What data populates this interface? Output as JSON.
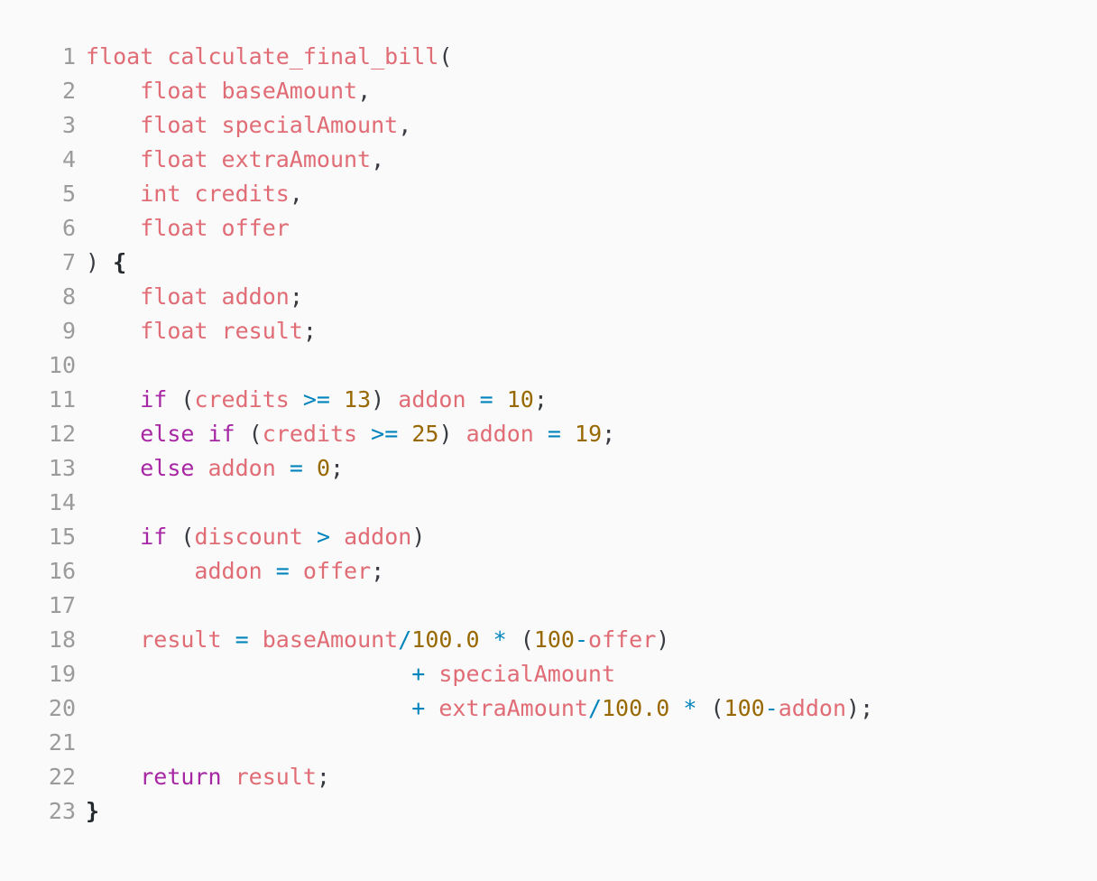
{
  "editor": {
    "language": "c",
    "background_color": "#fafafa",
    "gutter_color": "#9b9b9b",
    "palette": {
      "identifier": "#e06c75",
      "keyword": "#a626a4",
      "number": "#986801",
      "operator": "#0184bc",
      "punctuation": "#383a42",
      "brace": "#24292e"
    },
    "total_lines": 23
  },
  "code": {
    "lines": [
      {
        "number": "1",
        "text": "float calculate_final_bill(",
        "tokens": [
          {
            "t": "float",
            "c": "tok-type"
          },
          {
            "t": " ",
            "c": "tok-plain"
          },
          {
            "t": "calculate_final_bill",
            "c": "tok-fn"
          },
          {
            "t": "(",
            "c": "tok-paren"
          }
        ]
      },
      {
        "number": "2",
        "text": "    float baseAmount,",
        "tokens": [
          {
            "t": "    ",
            "c": "tok-plain"
          },
          {
            "t": "float",
            "c": "tok-type"
          },
          {
            "t": " ",
            "c": "tok-plain"
          },
          {
            "t": "baseAmount",
            "c": "tok-ident"
          },
          {
            "t": ",",
            "c": "tok-punct"
          }
        ]
      },
      {
        "number": "3",
        "text": "    float specialAmount,",
        "tokens": [
          {
            "t": "    ",
            "c": "tok-plain"
          },
          {
            "t": "float",
            "c": "tok-type"
          },
          {
            "t": " ",
            "c": "tok-plain"
          },
          {
            "t": "specialAmount",
            "c": "tok-ident"
          },
          {
            "t": ",",
            "c": "tok-punct"
          }
        ]
      },
      {
        "number": "4",
        "text": "    float extraAmount,",
        "tokens": [
          {
            "t": "    ",
            "c": "tok-plain"
          },
          {
            "t": "float",
            "c": "tok-type"
          },
          {
            "t": " ",
            "c": "tok-plain"
          },
          {
            "t": "extraAmount",
            "c": "tok-ident"
          },
          {
            "t": ",",
            "c": "tok-punct"
          }
        ]
      },
      {
        "number": "5",
        "text": "    int credits,",
        "tokens": [
          {
            "t": "    ",
            "c": "tok-plain"
          },
          {
            "t": "int",
            "c": "tok-type"
          },
          {
            "t": " ",
            "c": "tok-plain"
          },
          {
            "t": "credits",
            "c": "tok-ident"
          },
          {
            "t": ",",
            "c": "tok-punct"
          }
        ]
      },
      {
        "number": "6",
        "text": "    float offer",
        "tokens": [
          {
            "t": "    ",
            "c": "tok-plain"
          },
          {
            "t": "float",
            "c": "tok-type"
          },
          {
            "t": " ",
            "c": "tok-plain"
          },
          {
            "t": "offer",
            "c": "tok-ident"
          }
        ]
      },
      {
        "number": "7",
        "text": ") {",
        "tokens": [
          {
            "t": ")",
            "c": "tok-paren"
          },
          {
            "t": " ",
            "c": "tok-plain"
          },
          {
            "t": "{",
            "c": "tok-brace"
          }
        ]
      },
      {
        "number": "8",
        "text": "    float addon;",
        "tokens": [
          {
            "t": "    ",
            "c": "tok-plain"
          },
          {
            "t": "float",
            "c": "tok-type"
          },
          {
            "t": " ",
            "c": "tok-plain"
          },
          {
            "t": "addon",
            "c": "tok-ident"
          },
          {
            "t": ";",
            "c": "tok-punct"
          }
        ]
      },
      {
        "number": "9",
        "text": "    float result;",
        "tokens": [
          {
            "t": "    ",
            "c": "tok-plain"
          },
          {
            "t": "float",
            "c": "tok-type"
          },
          {
            "t": " ",
            "c": "tok-plain"
          },
          {
            "t": "result",
            "c": "tok-ident"
          },
          {
            "t": ";",
            "c": "tok-punct"
          }
        ]
      },
      {
        "number": "10",
        "text": "",
        "tokens": []
      },
      {
        "number": "11",
        "text": "    if (credits >= 13) addon = 10;",
        "tokens": [
          {
            "t": "    ",
            "c": "tok-plain"
          },
          {
            "t": "if",
            "c": "tok-kw"
          },
          {
            "t": " ",
            "c": "tok-plain"
          },
          {
            "t": "(",
            "c": "tok-paren"
          },
          {
            "t": "credits",
            "c": "tok-ident"
          },
          {
            "t": " ",
            "c": "tok-plain"
          },
          {
            "t": ">=",
            "c": "tok-op"
          },
          {
            "t": " ",
            "c": "tok-plain"
          },
          {
            "t": "13",
            "c": "tok-num"
          },
          {
            "t": ")",
            "c": "tok-paren"
          },
          {
            "t": " ",
            "c": "tok-plain"
          },
          {
            "t": "addon",
            "c": "tok-ident"
          },
          {
            "t": " ",
            "c": "tok-plain"
          },
          {
            "t": "=",
            "c": "tok-op"
          },
          {
            "t": " ",
            "c": "tok-plain"
          },
          {
            "t": "10",
            "c": "tok-num"
          },
          {
            "t": ";",
            "c": "tok-punct"
          }
        ]
      },
      {
        "number": "12",
        "text": "    else if (credits >= 25) addon = 19;",
        "tokens": [
          {
            "t": "    ",
            "c": "tok-plain"
          },
          {
            "t": "else",
            "c": "tok-kw"
          },
          {
            "t": " ",
            "c": "tok-plain"
          },
          {
            "t": "if",
            "c": "tok-kw"
          },
          {
            "t": " ",
            "c": "tok-plain"
          },
          {
            "t": "(",
            "c": "tok-paren"
          },
          {
            "t": "credits",
            "c": "tok-ident"
          },
          {
            "t": " ",
            "c": "tok-plain"
          },
          {
            "t": ">=",
            "c": "tok-op"
          },
          {
            "t": " ",
            "c": "tok-plain"
          },
          {
            "t": "25",
            "c": "tok-num"
          },
          {
            "t": ")",
            "c": "tok-paren"
          },
          {
            "t": " ",
            "c": "tok-plain"
          },
          {
            "t": "addon",
            "c": "tok-ident"
          },
          {
            "t": " ",
            "c": "tok-plain"
          },
          {
            "t": "=",
            "c": "tok-op"
          },
          {
            "t": " ",
            "c": "tok-plain"
          },
          {
            "t": "19",
            "c": "tok-num"
          },
          {
            "t": ";",
            "c": "tok-punct"
          }
        ]
      },
      {
        "number": "13",
        "text": "    else addon = 0;",
        "tokens": [
          {
            "t": "    ",
            "c": "tok-plain"
          },
          {
            "t": "else",
            "c": "tok-kw"
          },
          {
            "t": " ",
            "c": "tok-plain"
          },
          {
            "t": "addon",
            "c": "tok-ident"
          },
          {
            "t": " ",
            "c": "tok-plain"
          },
          {
            "t": "=",
            "c": "tok-op"
          },
          {
            "t": " ",
            "c": "tok-plain"
          },
          {
            "t": "0",
            "c": "tok-num"
          },
          {
            "t": ";",
            "c": "tok-punct"
          }
        ]
      },
      {
        "number": "14",
        "text": "",
        "tokens": []
      },
      {
        "number": "15",
        "text": "    if (discount > addon)",
        "tokens": [
          {
            "t": "    ",
            "c": "tok-plain"
          },
          {
            "t": "if",
            "c": "tok-kw"
          },
          {
            "t": " ",
            "c": "tok-plain"
          },
          {
            "t": "(",
            "c": "tok-paren"
          },
          {
            "t": "discount",
            "c": "tok-ident"
          },
          {
            "t": " ",
            "c": "tok-plain"
          },
          {
            "t": ">",
            "c": "tok-op"
          },
          {
            "t": " ",
            "c": "tok-plain"
          },
          {
            "t": "addon",
            "c": "tok-ident"
          },
          {
            "t": ")",
            "c": "tok-paren"
          }
        ]
      },
      {
        "number": "16",
        "text": "        addon = offer;",
        "tokens": [
          {
            "t": "        ",
            "c": "tok-plain"
          },
          {
            "t": "addon",
            "c": "tok-ident"
          },
          {
            "t": " ",
            "c": "tok-plain"
          },
          {
            "t": "=",
            "c": "tok-op"
          },
          {
            "t": " ",
            "c": "tok-plain"
          },
          {
            "t": "offer",
            "c": "tok-ident"
          },
          {
            "t": ";",
            "c": "tok-punct"
          }
        ]
      },
      {
        "number": "17",
        "text": "",
        "tokens": []
      },
      {
        "number": "18",
        "text": "    result = baseAmount/100.0 * (100-offer)",
        "tokens": [
          {
            "t": "    ",
            "c": "tok-plain"
          },
          {
            "t": "result",
            "c": "tok-ident"
          },
          {
            "t": " ",
            "c": "tok-plain"
          },
          {
            "t": "=",
            "c": "tok-op"
          },
          {
            "t": " ",
            "c": "tok-plain"
          },
          {
            "t": "baseAmount",
            "c": "tok-ident"
          },
          {
            "t": "/",
            "c": "tok-op"
          },
          {
            "t": "100.0",
            "c": "tok-num"
          },
          {
            "t": " ",
            "c": "tok-plain"
          },
          {
            "t": "*",
            "c": "tok-op"
          },
          {
            "t": " ",
            "c": "tok-plain"
          },
          {
            "t": "(",
            "c": "tok-paren"
          },
          {
            "t": "100",
            "c": "tok-num"
          },
          {
            "t": "-",
            "c": "tok-op"
          },
          {
            "t": "offer",
            "c": "tok-ident"
          },
          {
            "t": ")",
            "c": "tok-paren"
          }
        ]
      },
      {
        "number": "19",
        "text": "                        + specialAmount",
        "tokens": [
          {
            "t": "                        ",
            "c": "tok-plain"
          },
          {
            "t": "+",
            "c": "tok-op"
          },
          {
            "t": " ",
            "c": "tok-plain"
          },
          {
            "t": "specialAmount",
            "c": "tok-ident"
          }
        ]
      },
      {
        "number": "20",
        "text": "                        + extraAmount/100.0 * (100-addon);",
        "tokens": [
          {
            "t": "                        ",
            "c": "tok-plain"
          },
          {
            "t": "+",
            "c": "tok-op"
          },
          {
            "t": " ",
            "c": "tok-plain"
          },
          {
            "t": "extraAmount",
            "c": "tok-ident"
          },
          {
            "t": "/",
            "c": "tok-op"
          },
          {
            "t": "100.0",
            "c": "tok-num"
          },
          {
            "t": " ",
            "c": "tok-plain"
          },
          {
            "t": "*",
            "c": "tok-op"
          },
          {
            "t": " ",
            "c": "tok-plain"
          },
          {
            "t": "(",
            "c": "tok-paren"
          },
          {
            "t": "100",
            "c": "tok-num"
          },
          {
            "t": "-",
            "c": "tok-op"
          },
          {
            "t": "addon",
            "c": "tok-ident"
          },
          {
            "t": ")",
            "c": "tok-paren"
          },
          {
            "t": ";",
            "c": "tok-punct"
          }
        ]
      },
      {
        "number": "21",
        "text": "",
        "tokens": []
      },
      {
        "number": "22",
        "text": "    return result;",
        "tokens": [
          {
            "t": "    ",
            "c": "tok-plain"
          },
          {
            "t": "return",
            "c": "tok-kw"
          },
          {
            "t": " ",
            "c": "tok-plain"
          },
          {
            "t": "result",
            "c": "tok-ident"
          },
          {
            "t": ";",
            "c": "tok-punct"
          }
        ]
      },
      {
        "number": "23",
        "text": "}",
        "tokens": [
          {
            "t": "}",
            "c": "tok-brace"
          }
        ]
      }
    ]
  }
}
